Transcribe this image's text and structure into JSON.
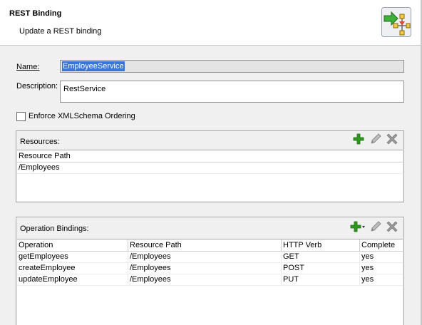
{
  "header": {
    "title": "REST Binding",
    "subtitle": "Update a REST binding",
    "icon": "rest-binding-icon"
  },
  "form": {
    "name_label": "Name:",
    "name_value": "EmployeeService",
    "description_label": "Description:",
    "description_value": "RestService",
    "enforce_label": "Enforce XMLSchema Ordering",
    "enforce_checked": false
  },
  "resources": {
    "title": "Resources:",
    "columns": [
      "Resource Path"
    ],
    "rows": [
      [
        "/Employees"
      ]
    ]
  },
  "operations": {
    "title": "Operation Bindings:",
    "columns": [
      "Operation",
      "Resource Path",
      "HTTP Verb",
      "Complete"
    ],
    "rows": [
      [
        "getEmployees",
        "/Employees",
        "GET",
        "yes"
      ],
      [
        "createEmployee",
        "/Employees",
        "POST",
        "yes"
      ],
      [
        "updateEmployee",
        "/Employees",
        "PUT",
        "yes"
      ]
    ]
  },
  "colors": {
    "add": "#2e9a1e",
    "selection": "#3875d7"
  }
}
